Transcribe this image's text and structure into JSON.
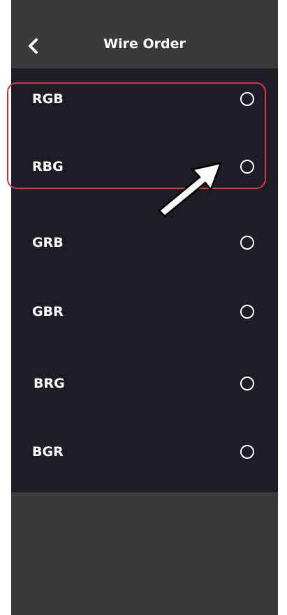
{
  "header": {
    "title": "Wire Order",
    "back_icon": "chevron-left-icon"
  },
  "options": [
    {
      "label": "RGB",
      "selected": false
    },
    {
      "label": "RBG",
      "selected": false
    },
    {
      "label": "GRB",
      "selected": false
    },
    {
      "label": "GBR",
      "selected": false
    },
    {
      "label": "BRG",
      "selected": false
    },
    {
      "label": "BGR",
      "selected": false
    }
  ],
  "colors": {
    "background": "#3b3a38",
    "list_background": "#1c1d26",
    "text": "#ffffff",
    "annotation": "#d8333e"
  }
}
